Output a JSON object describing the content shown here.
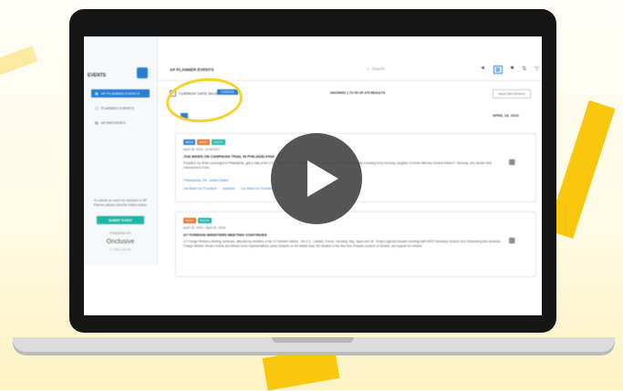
{
  "sidebar": {
    "title": "EVENTS",
    "items": [
      {
        "label": "AP PLANNER EVENTS",
        "active": true
      },
      {
        "label": "PLANNED EVENTS",
        "active": false
      },
      {
        "label": "AP ARCHIVES",
        "active": false
      }
    ],
    "promo": "To submit an event for inclusion in AP Planner please click the button below.",
    "cta": "SUBMIT EVENT",
    "powered": "POWERED BY",
    "brand": "Onclusive",
    "copyright": "© ONCLUSIVE"
  },
  "topbar": {
    "title": "AP PLANNER EVENTS",
    "search_placeholder": "Search"
  },
  "toolbar": {
    "current_date_selection": "CURRENT DATE SELECTION",
    "change_button": "CHANGE",
    "showing": "SHOWING 1 TO 50 OF 475 RESULTS",
    "sort": "SELECTED PROFILE"
  },
  "date_header": "APRIL 18, 2024",
  "cards": [
    {
      "badges": [
        {
          "label": "NEWS",
          "color": "#2a7fd4"
        },
        {
          "label": "ENTRY",
          "color": "#e8722a"
        },
        {
          "label": "PHOTO",
          "color": "#1fb6a8"
        }
      ],
      "date": "April 18, 2024, 12:45 EDT",
      "title": "JOE BIDEN ON CAMPAIGN TRAIL IN PHILADELPHIA",
      "body": "President Joe Biden campaigns in Philadelphia, gets a rally at the U.S. PRESIDENT JOE BIDEN and other members of the Kennedy family, including Kerry Kennedy, daughter of former Attorney General Robert F. Kennedy, who declare their endorsement of him.",
      "location": "Philadelphia, PA · United States",
      "links": [
        "Joe Biden for President",
        "JoeBiden",
        "Joe Biden for President"
      ]
    },
    {
      "badges": [
        {
          "label": "ENTRY",
          "color": "#e8722a"
        },
        {
          "label": "PHOTO",
          "color": "#1fb6a8"
        }
      ],
      "date": "April 18, 2024 - April 20, 2024",
      "title": "G7 FOREIGN MINISTERS MEETING CONTINUES",
      "body": "G7 Foreign Ministers Meeting continues, attended by ministers of the G7 member nations - the U.S., Canada, France, Germany, Italy, Japan and UK. Today's agenda includes meetings with NATO Secretary General Jens Stoltenberg and Ukrainian Foreign Minister Dmytro Kuleba and African Union representatives; press sessions on the Middle East, the situation in the Red Sea, Russia's invasion of Ukraine, and support for Ukraine."
    }
  ],
  "colors": {
    "accent": "#2a7fd4",
    "highlight": "#f6d12a",
    "stripe": "#f9c80e"
  }
}
